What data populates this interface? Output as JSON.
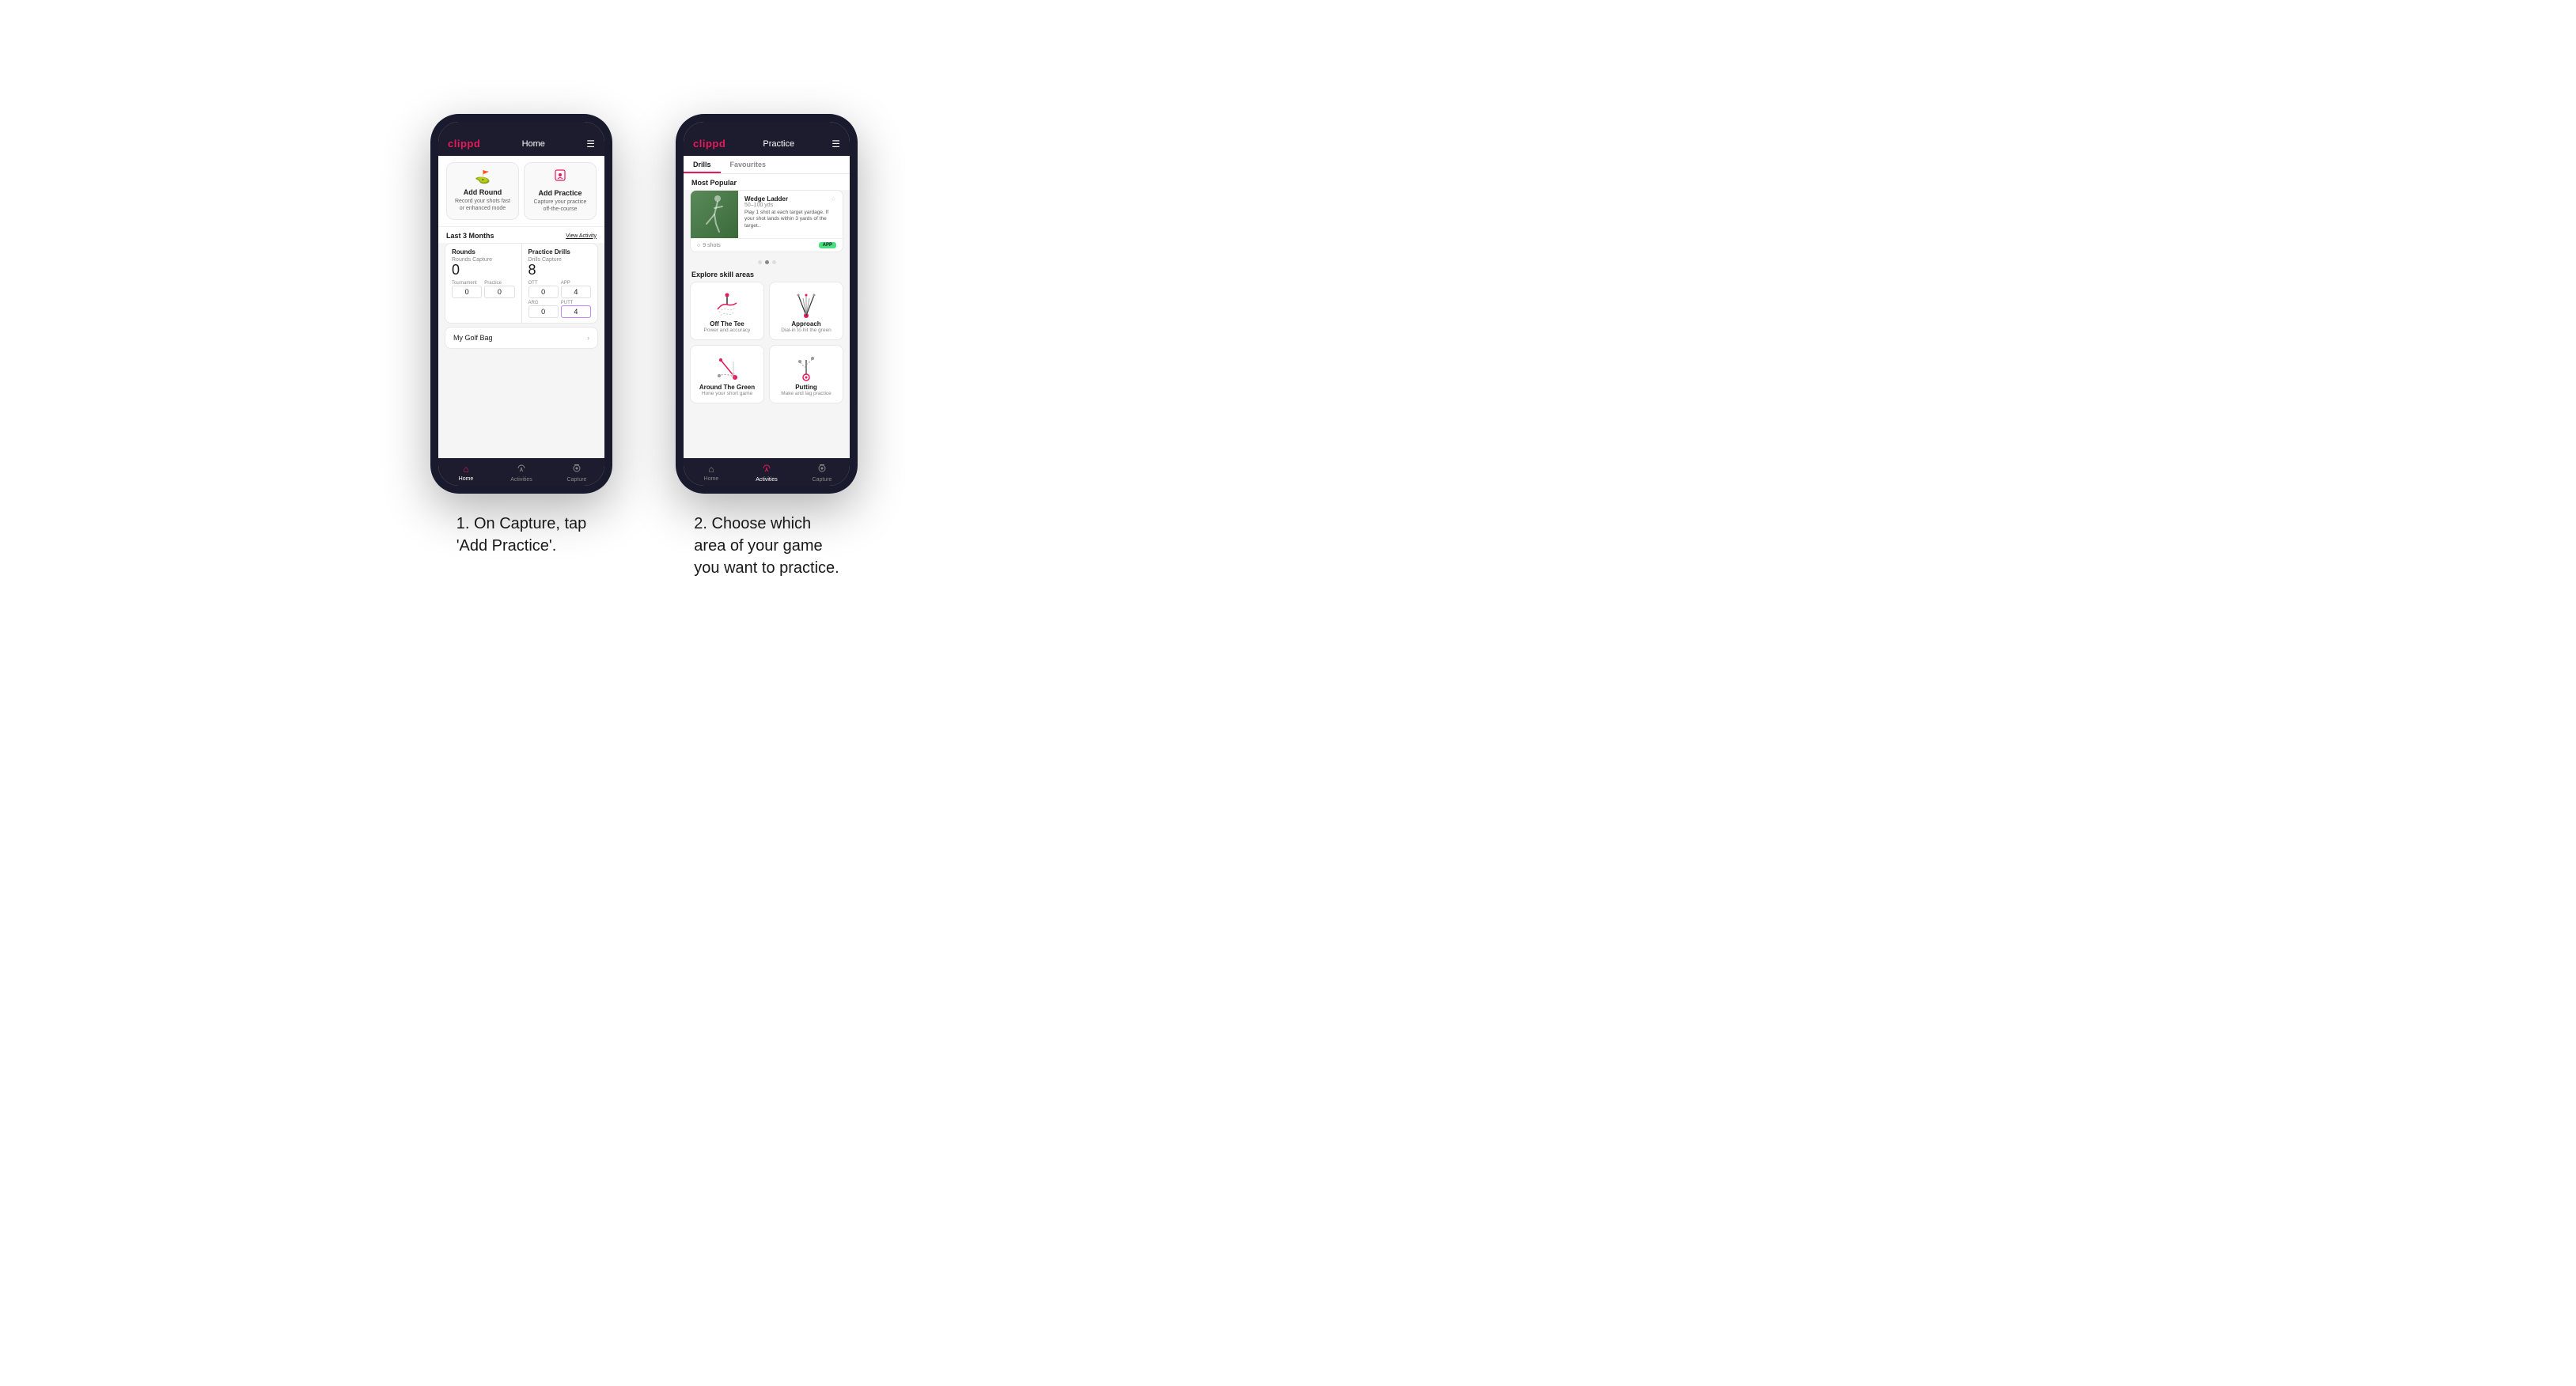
{
  "phone1": {
    "header": {
      "logo": "clippd",
      "title": "Home",
      "menu_icon": "☰"
    },
    "add_round": {
      "icon": "⛳",
      "title": "Add Round",
      "desc": "Record your shots fast or enhanced mode"
    },
    "add_practice": {
      "icon": "🏌",
      "title": "Add Practice",
      "desc": "Capture your practice off-the-course"
    },
    "last_months": "Last 3 Months",
    "view_activity": "View Activity",
    "rounds_section": {
      "title": "Rounds",
      "rounds_capture_label": "Rounds Capture",
      "rounds_capture_value": "0",
      "tournament_label": "Tournament",
      "tournament_value": "0",
      "practice_label": "Practice",
      "practice_value": "0"
    },
    "practice_section": {
      "title": "Practice Drills",
      "drills_capture_label": "Drills Capture",
      "drills_capture_value": "8",
      "ott_label": "OTT",
      "ott_value": "0",
      "app_label": "APP",
      "app_value": "4",
      "arg_label": "ARG",
      "arg_value": "0",
      "putt_label": "PUTT",
      "putt_value": "4"
    },
    "golf_bag": "My Golf Bag",
    "nav": {
      "home": "Home",
      "activities": "Activities",
      "capture": "Capture"
    }
  },
  "phone2": {
    "header": {
      "logo": "clippd",
      "title": "Practice",
      "menu_icon": "☰"
    },
    "tabs": {
      "drills": "Drills",
      "favourites": "Favourites"
    },
    "most_popular": "Most Popular",
    "featured": {
      "title": "Wedge Ladder",
      "yardage": "50–100 yds",
      "desc": "Play 1 shot at each target yardage. If your shot lands within 3 yards of the target..",
      "shots": "9 shots",
      "badge": "APP"
    },
    "explore": "Explore skill areas",
    "skills": [
      {
        "name": "Off The Tee",
        "desc": "Power and accuracy",
        "icon_type": "tee"
      },
      {
        "name": "Approach",
        "desc": "Dial-in to hit the green",
        "icon_type": "approach"
      },
      {
        "name": "Around The Green",
        "desc": "Hone your short game",
        "icon_type": "atg"
      },
      {
        "name": "Putting",
        "desc": "Make and lag practice",
        "icon_type": "putting"
      }
    ],
    "nav": {
      "home": "Home",
      "activities": "Activities",
      "capture": "Capture"
    }
  },
  "captions": {
    "caption1": "1. On Capture, tap\n'Add Practice'.",
    "caption2": "2. Choose which\narea of your game\nyou want to practice."
  }
}
